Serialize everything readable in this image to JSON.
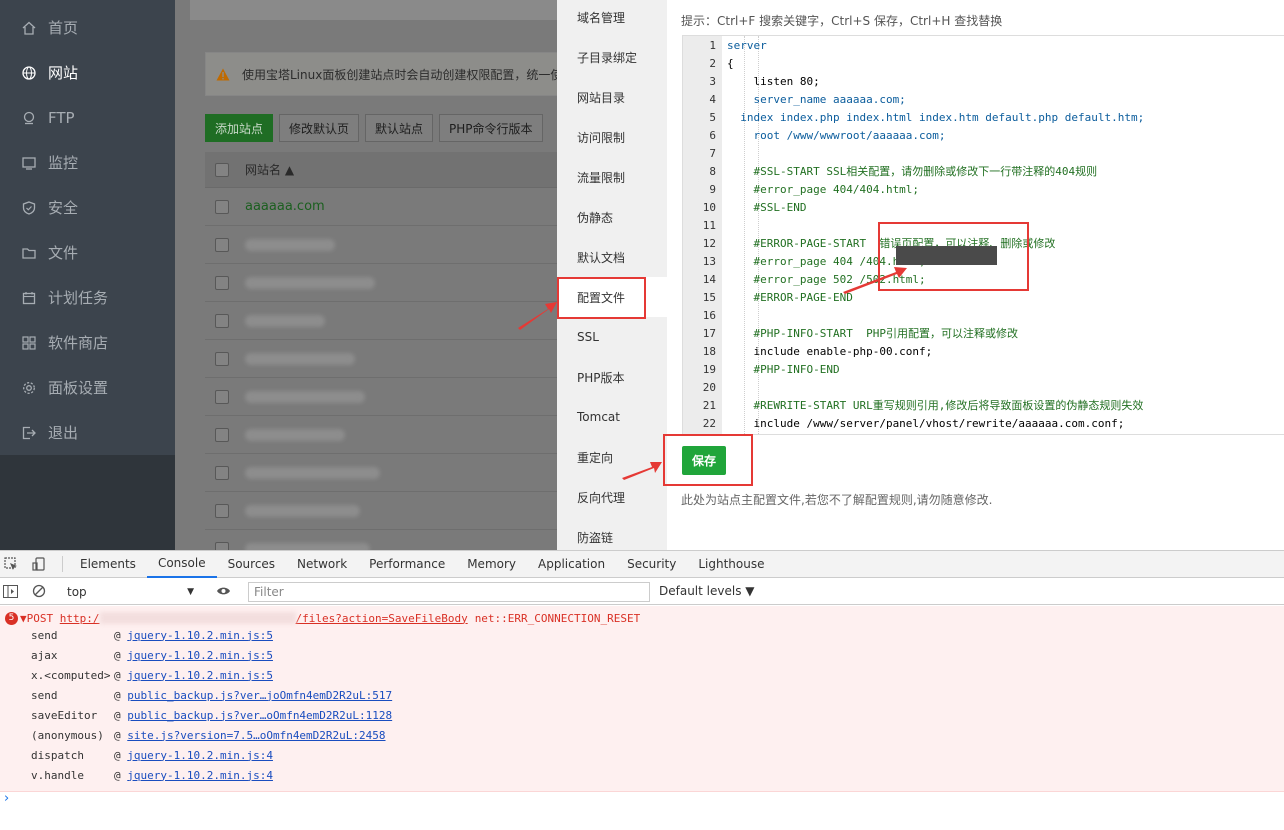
{
  "nav": {
    "items": [
      {
        "label": "首页",
        "icon": "home-icon"
      },
      {
        "label": "网站",
        "icon": "globe-icon"
      },
      {
        "label": "FTP",
        "icon": "ftp-icon"
      },
      {
        "label": "监控",
        "icon": "monitor-icon"
      },
      {
        "label": "安全",
        "icon": "shield-icon"
      },
      {
        "label": "文件",
        "icon": "folder-icon"
      },
      {
        "label": "计划任务",
        "icon": "calendar-icon"
      },
      {
        "label": "软件商店",
        "icon": "grid-icon"
      },
      {
        "label": "面板设置",
        "icon": "gear-icon"
      },
      {
        "label": "退出",
        "icon": "logout-icon"
      }
    ],
    "active_index": 1
  },
  "main": {
    "notice": "使用宝塔Linux面板创建站点时会自动创建权限配置，统一使",
    "buttons": [
      "添加站点",
      "修改默认页",
      "默认站点",
      "PHP命令行版本"
    ],
    "table_header": "网站名 ▲",
    "first_site": "aaaaaa.com"
  },
  "panel": {
    "tabs": [
      "域名管理",
      "子目录绑定",
      "网站目录",
      "访问限制",
      "流量限制",
      "伪静态",
      "默认文档",
      "配置文件",
      "SSL",
      "PHP版本",
      "Tomcat",
      "重定向",
      "反向代理",
      "防盗链"
    ],
    "active_tab_index": 7,
    "hint": "提示：Ctrl+F 搜索关键字，Ctrl+S 保存，Ctrl+H 查找替换",
    "save_label": "保存",
    "note": "此处为站点主配置文件,若您不了解配置规则,请勿随意修改.",
    "code_lines": [
      {
        "n": "1",
        "text": "server",
        "cls": "kw"
      },
      {
        "n": "2",
        "text": "{",
        "cls": ""
      },
      {
        "n": "3",
        "text": "    listen 80;",
        "cls": ""
      },
      {
        "n": "4",
        "text": "    server_name aaaaaa.com;",
        "cls": "kw"
      },
      {
        "n": "5",
        "text": "  index index.php index.html index.htm default.php default.htm;",
        "cls": "kw"
      },
      {
        "n": "6",
        "text": "    root /www/wwwroot/aaaaaa.com;",
        "cls": "kw"
      },
      {
        "n": "7",
        "text": "",
        "cls": ""
      },
      {
        "n": "8",
        "text": "    #SSL-START SSL相关配置，请勿删除或修改下一行带注释的404规则",
        "cls": "cm"
      },
      {
        "n": "9",
        "text": "    #error_page 404/404.html;",
        "cls": "cm"
      },
      {
        "n": "10",
        "text": "    #SSL-END",
        "cls": "cm"
      },
      {
        "n": "11",
        "text": "",
        "cls": ""
      },
      {
        "n": "12",
        "text": "    #ERROR-PAGE-START  错误页配置，可以注释、删除或修改",
        "cls": "cm"
      },
      {
        "n": "13",
        "text": "    #error_page 404 /404.html;",
        "cls": "cm"
      },
      {
        "n": "14",
        "text": "    #error_page 502 /502.html;",
        "cls": "cm"
      },
      {
        "n": "15",
        "text": "    #ERROR-PAGE-END",
        "cls": "cm"
      },
      {
        "n": "16",
        "text": "",
        "cls": ""
      },
      {
        "n": "17",
        "text": "    #PHP-INFO-START  PHP引用配置，可以注释或修改",
        "cls": "cm"
      },
      {
        "n": "18",
        "text": "    include enable-php-00.conf;",
        "cls": ""
      },
      {
        "n": "19",
        "text": "    #PHP-INFO-END",
        "cls": "cm"
      },
      {
        "n": "20",
        "text": "",
        "cls": ""
      },
      {
        "n": "21",
        "text": "    #REWRITE-START URL重写规则引用,修改后将导致面板设置的伪静态规则失效",
        "cls": "cm"
      },
      {
        "n": "22",
        "text": "    include /www/server/panel/vhost/rewrite/aaaaaa.com.conf;",
        "cls": ""
      }
    ]
  },
  "devtools": {
    "tabs": [
      "Elements",
      "Console",
      "Sources",
      "Network",
      "Performance",
      "Memory",
      "Application",
      "Security",
      "Lighthouse"
    ],
    "active_tab": "Console",
    "context": "top",
    "filter_placeholder": "Filter",
    "levels": "Default levels ▼",
    "error_count": "5",
    "error_method": "▼POST ",
    "error_url_start": "http:/",
    "error_url_end": "/files?action=SaveFileBody",
    "error_text": "net::ERR_CONNECTION_RESET",
    "stack": [
      {
        "fn": "send",
        "src": "jquery-1.10.2.min.js:5"
      },
      {
        "fn": "ajax",
        "src": "jquery-1.10.2.min.js:5"
      },
      {
        "fn": "x.<computed>",
        "src": "jquery-1.10.2.min.js:5"
      },
      {
        "fn": "send",
        "src": "public_backup.js?ver…joOmfn4emD2R2uL:517"
      },
      {
        "fn": "saveEditor",
        "src": "public_backup.js?ver…oOmfn4emD2R2uL:1128"
      },
      {
        "fn": "(anonymous)",
        "src": "site.js?version=7.5…oOmfn4emD2R2uL:2458"
      },
      {
        "fn": "dispatch",
        "src": "jquery-1.10.2.min.js:4"
      },
      {
        "fn": "v.handle",
        "src": "jquery-1.10.2.min.js:4"
      }
    ],
    "prompt": "›"
  },
  "colors": {
    "accent_green": "#20a53a",
    "highlight_red": "#e53935",
    "error_bg": "#fef0f0"
  }
}
